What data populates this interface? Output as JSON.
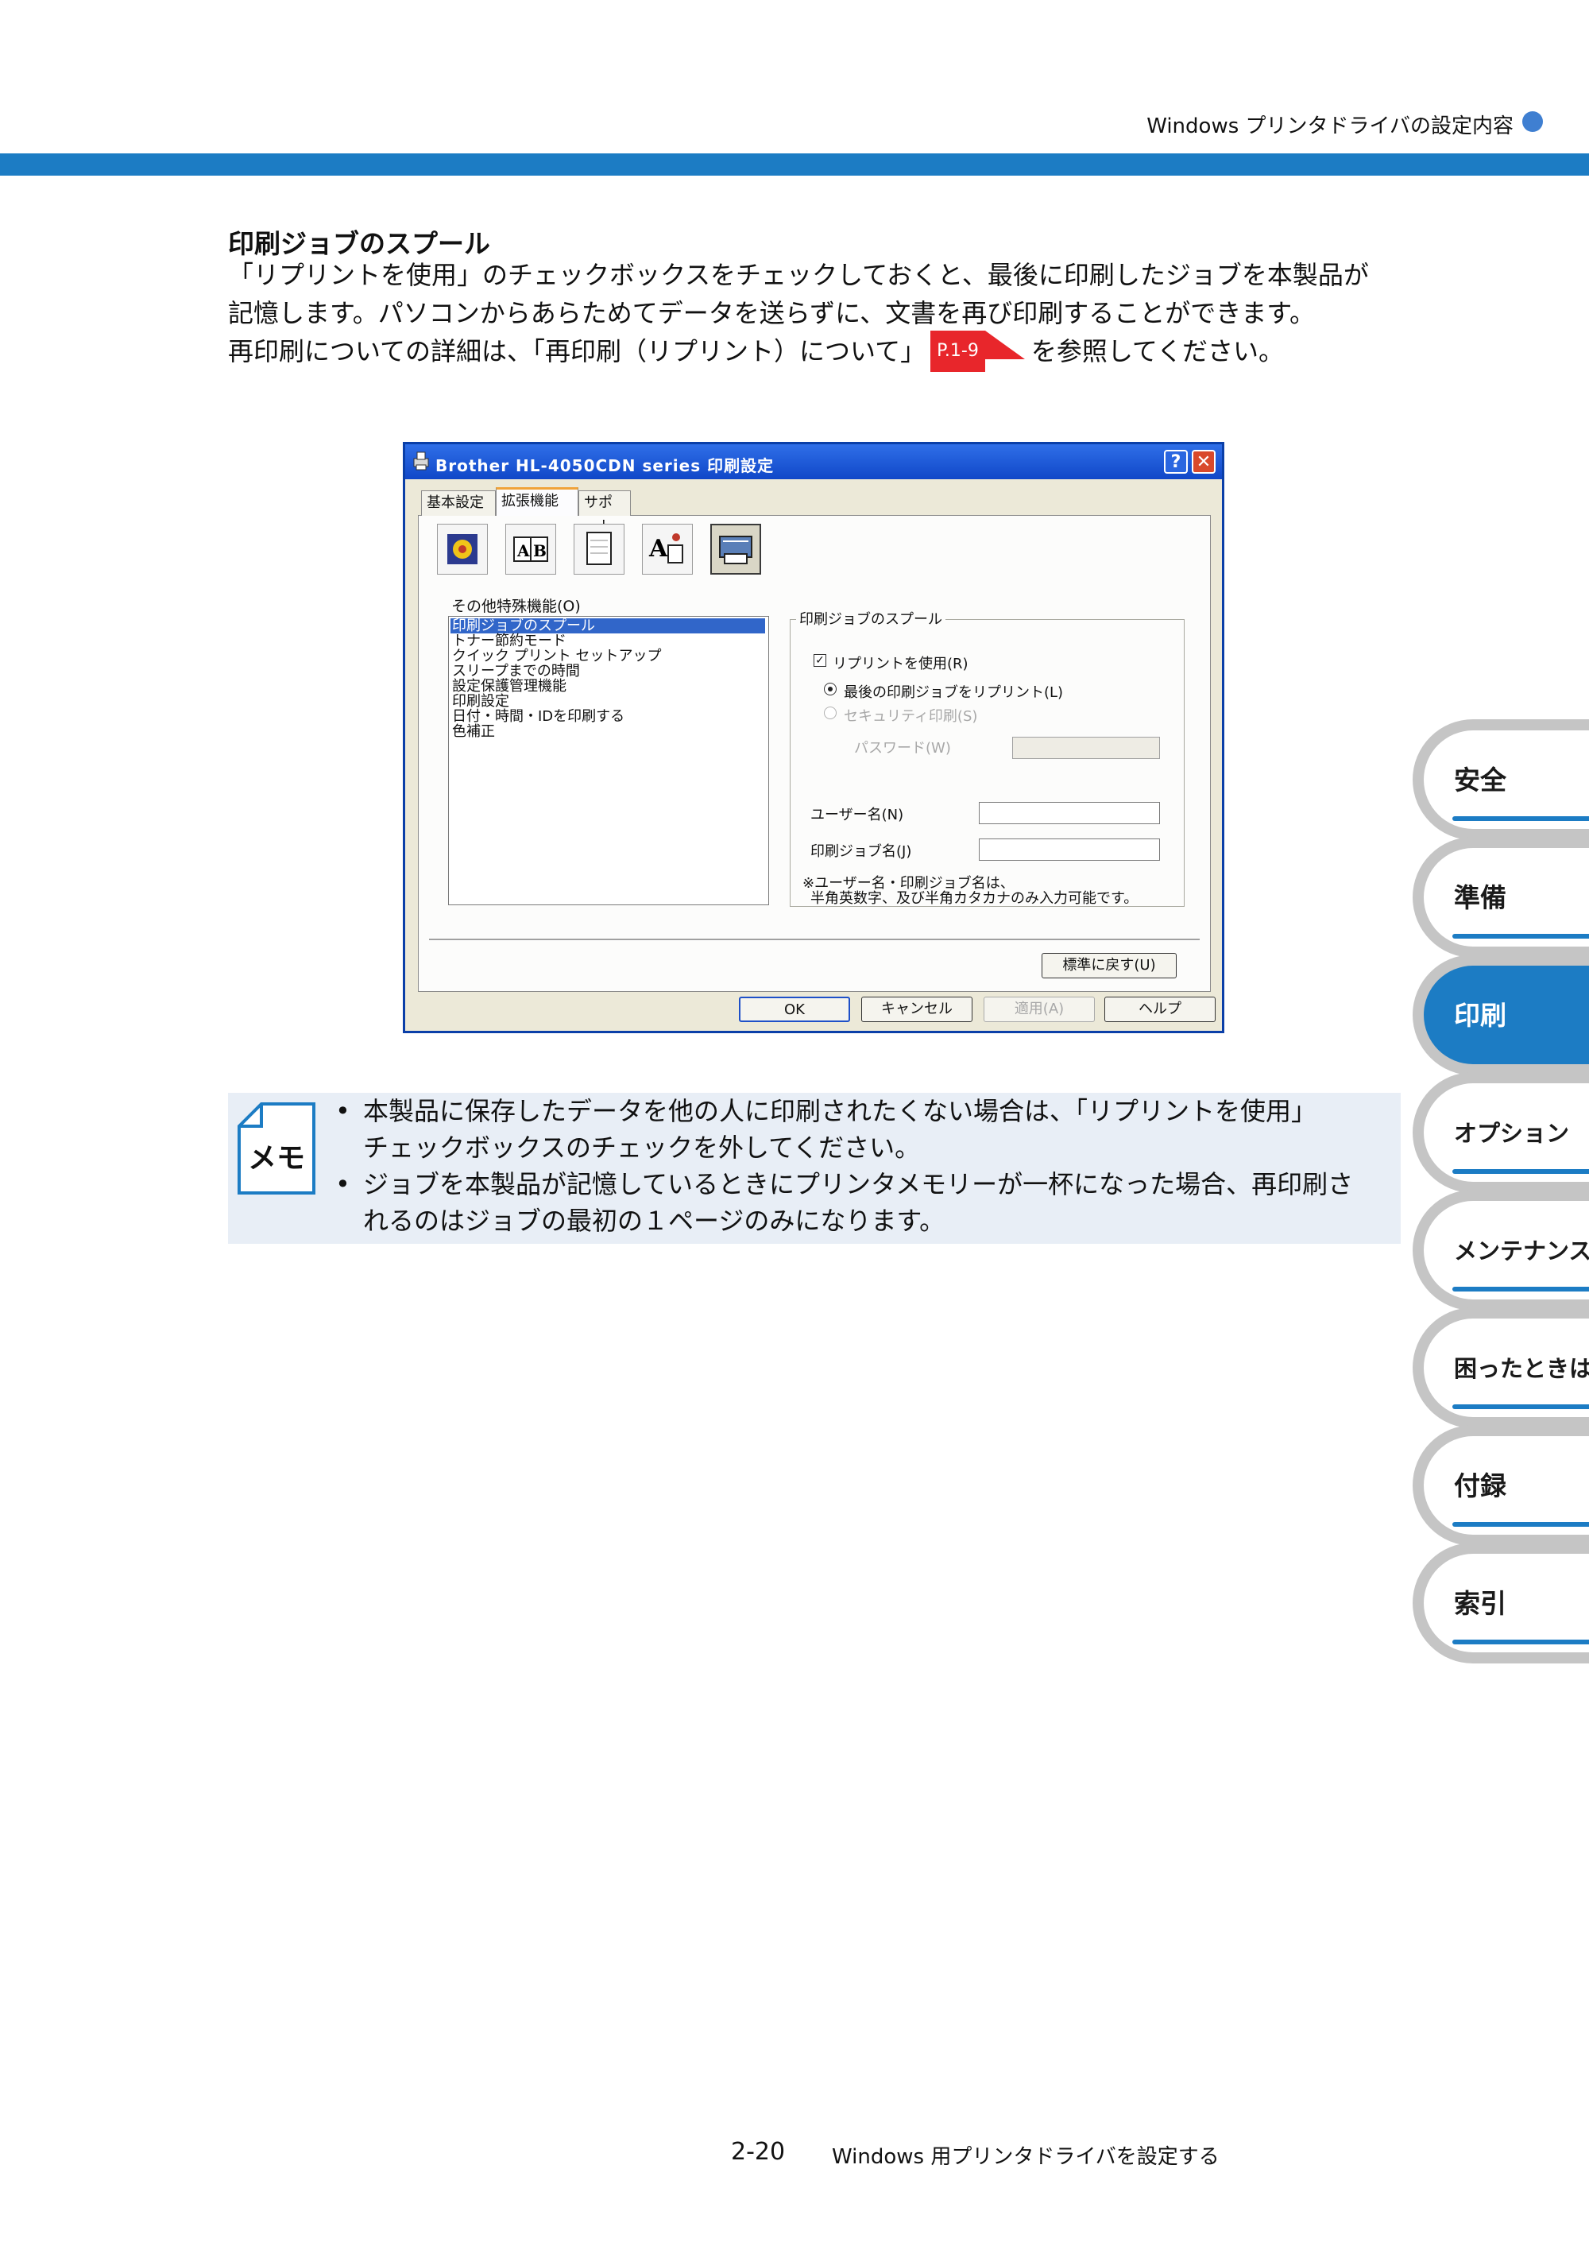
{
  "header": {
    "title": "Windows プリンタドライバの設定内容"
  },
  "section": {
    "title": "印刷ジョブのスプール",
    "line1": "「リプリントを使用」のチェックボックスをチェックしておくと、最後に印刷したジョブを本製品が",
    "line2": "記憶します。パソコンからあらためてデータを送らずに、文書を再び印刷することができます。",
    "line3_pre": "再印刷についての詳細は、「再印刷（リプリント）について」",
    "line3_ref": "P.1-9",
    "line3_post": "を参照してください。"
  },
  "dialog": {
    "title": "Brother HL-4050CDN series 印刷設定",
    "help_glyph": "?",
    "close_glyph": "✕",
    "tabs": [
      "基本設定",
      "拡張機能",
      "サポート"
    ],
    "feature_icons": [
      "color-icon",
      "ab-scaling-icon",
      "copy-watermark-icon",
      "font-icon",
      "other-features-icon"
    ],
    "list_label": "その他特殊機能(O)",
    "list_items": [
      "印刷ジョブのスプール",
      "トナー節約モード",
      "クイック プリント セットアップ",
      "スリープまでの時間",
      "設定保護管理機能",
      "印刷設定",
      "日付・時間・IDを印刷する",
      "色補正"
    ],
    "group_title": "印刷ジョブのスプール",
    "use_reprint_label": "リプリントを使用(R)",
    "use_reprint_checked": true,
    "radio_last_job": "最後の印刷ジョブをリプリント(L)",
    "radio_secure": "セキュリティ印刷(S)",
    "password_label": "パスワード(W)",
    "password_value": "",
    "username_label": "ユーザー名(N)",
    "username_value": "",
    "jobname_label": "印刷ジョブ名(J)",
    "jobname_value": "",
    "note_line1": "※ユーザー名・印刷ジョブ名は、",
    "note_line2": "半角英数字、及び半角カタカナのみ入力可能です。",
    "restore_label": "標準に戻す(U)",
    "ok_label": "OK",
    "cancel_label": "キャンセル",
    "apply_label": "適用(A)",
    "help_label": "ヘルプ"
  },
  "memo": {
    "icon_text": "メモ",
    "bullet": "•",
    "b1_line1": "本製品に保存したデータを他の人に印刷されたくない場合は、「リプリントを使用」",
    "b1_line2": "チェックボックスのチェックを外してください。",
    "b2_line1": "ジョブを本製品が記憶しているときにプリンタメモリーが一杯になった場合、再印刷さ",
    "b2_line2": "れるのはジョブの最初の１ページのみになります。"
  },
  "side_tabs": [
    "安全",
    "準備",
    "印刷",
    "オプション",
    "メンテナンス",
    "困ったときは",
    "付録",
    "索引"
  ],
  "side_tab_active": "印刷",
  "footer": {
    "page": "2-20",
    "title": "Windows 用プリンタドライバを設定する"
  },
  "colors": {
    "accent": "#1c7cc4",
    "ref_badge": "#e8262b",
    "memo_bg": "#e8eef6"
  }
}
